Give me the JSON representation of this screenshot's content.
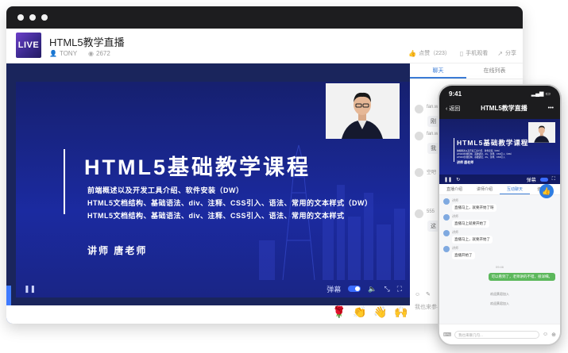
{
  "window": {
    "title": "HTML5教学直播"
  },
  "header": {
    "logo_text": "LIVE",
    "author": "TONY",
    "views": "2672",
    "actions": [
      "点赞（223）",
      "手机观看",
      "分享"
    ]
  },
  "video": {
    "title": "HTML5基础教学课程",
    "lines": [
      "前端概述以及开发工具介绍、软件安装（DW）",
      "HTML5文档结构、基础语法、div、注释、CSS引入、语法、常用的文本样式（DW）",
      "HTML5文档结构、基础语法、div、注释、CSS引入、语法、常用的文本样式"
    ],
    "teacher": "讲师   唐老师",
    "controls": {
      "danmu_label": "弹幕"
    }
  },
  "chat": {
    "tabs": [
      "聊天",
      "在线列表"
    ],
    "messages": [
      {
        "name": "fan.w",
        "text": "刚"
      },
      {
        "name": "fan.w",
        "text": "我"
      },
      {
        "name": "空吧",
        "text": ""
      },
      {
        "name": "555",
        "text": "这"
      }
    ],
    "input_tools": [
      "☺",
      "✎"
    ],
    "input_placeholder": "我也来参与..."
  },
  "gifts": [
    "🌹",
    "👏",
    "👋",
    "🙌"
  ],
  "phone": {
    "status_time": "9:41",
    "back_label": "返回",
    "nav_title": "HTML5教学直播",
    "video": {
      "title": "HTML5基础教学课程",
      "lines": [
        "前端概述以及开发工具介绍、软件安装（DW）",
        "HTML5文档结构、基础语法、div、注释、CSS引入（DW）",
        "HTML5文档结构、基础语法、div、注释、CSS引入"
      ],
      "teacher": "讲师   唐老师",
      "danmu": "弹幕"
    },
    "tabs": [
      "直播介绍",
      "讲师介绍",
      "互动聊天",
      "咨询顾问"
    ],
    "active_tab": 2,
    "messages": [
      {
        "name": "讲师",
        "text": "直播马上，就要开始了呀"
      },
      {
        "name": "讲师",
        "text": "直播马上就要开始了"
      },
      {
        "name": "讲师",
        "text": "直播马上，就要开始了"
      },
      {
        "name": "讲师",
        "text": "直播开始了"
      }
    ],
    "time_label": "09:46",
    "my_message": "可以看到了，老师讲的不错，很详细。",
    "welcome": [
      "欢迎黄君加入",
      "欢迎黄君加入"
    ],
    "input_placeholder": "我也来聊几句..."
  }
}
